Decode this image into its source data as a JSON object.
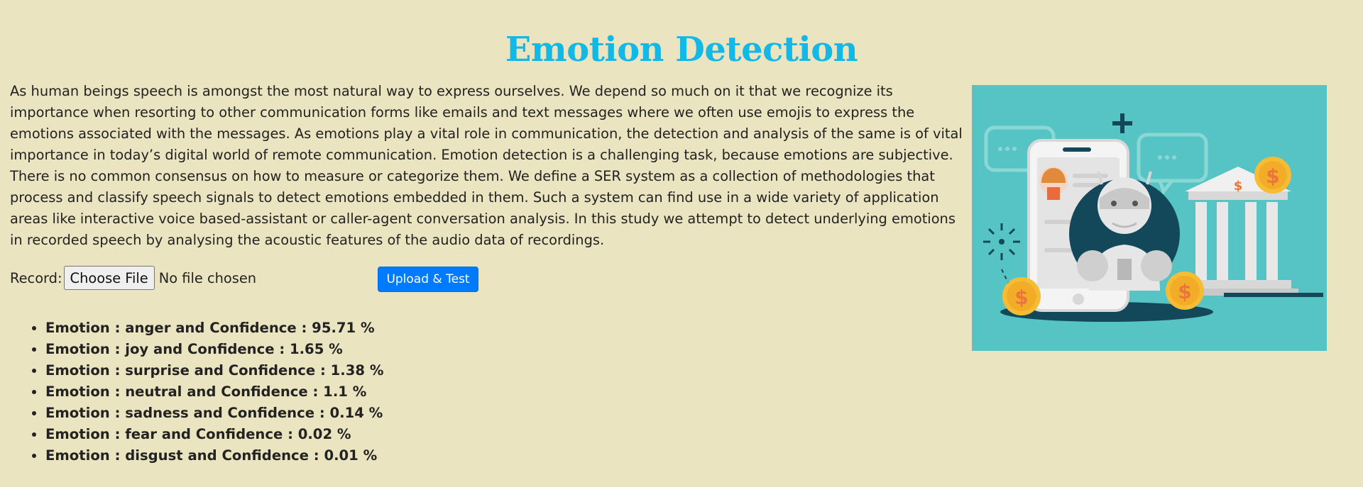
{
  "page": {
    "title": "Emotion Detection",
    "description": "As human beings speech is amongst the most natural way to express ourselves. We depend so much on it that we recognize its importance when resorting to other communication forms like emails and text messages where we often use emojis to express the emotions associated with the messages. As emotions play a vital role in communication, the detection and analysis of the same is of vital importance in today’s digital world of remote communication. Emotion detection is a challenging task, because emotions are subjective. There is no common consensus on how to measure or categorize them. We define a SER system as a collection of methodologies that process and classify speech signals to detect emotions embedded in them. Such a system can find use in a wide variety of application areas like interactive voice based-assistant or caller-agent conversation analysis. In this study we attempt to detect underlying emotions in recorded speech by analysing the acoustic features of the audio data of recordings."
  },
  "form": {
    "record_label": "Record:",
    "choose_file_label": "Choose File",
    "file_status": "No file chosen",
    "upload_label": "Upload & Test"
  },
  "results": [
    "Emotion : anger and Confidence : 95.71 %",
    "Emotion : joy and Confidence : 1.65 %",
    "Emotion : surprise and Confidence : 1.38 %",
    "Emotion : neutral and Confidence : 1.1 %",
    "Emotion : sadness and Confidence : 0.14 %",
    "Emotion : fear and Confidence : 0.02 %",
    "Emotion : disgust and Confidence : 0.01 %"
  ],
  "colors": {
    "background": "#ebe4c0",
    "title": "#12b8e6",
    "button": "#007bff",
    "illustration_bg": "#56c3c4"
  },
  "illustration": {
    "dollar_sign": "$"
  }
}
